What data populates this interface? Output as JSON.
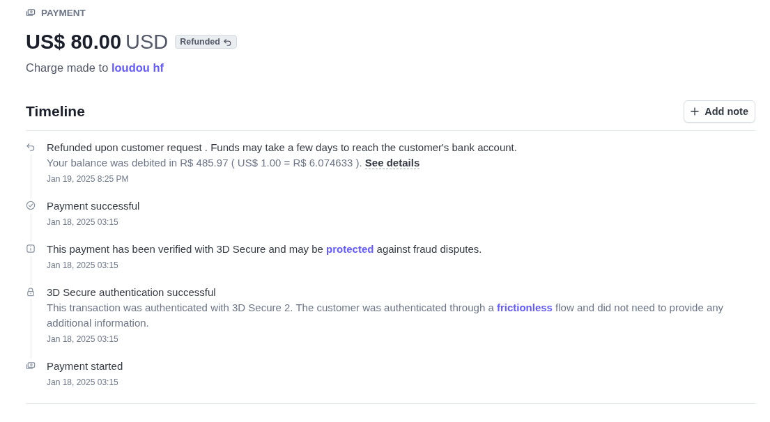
{
  "header": {
    "label": "PAYMENT",
    "amount": "US$ 80.00",
    "currency": "USD",
    "status": "Refunded",
    "description": [
      {
        "text": "Charge made to "
      },
      {
        "text": "loudou hf",
        "kind": "link"
      }
    ]
  },
  "timeline": {
    "title": "Timeline",
    "add_button": "Add note",
    "events": [
      {
        "kind": "refund",
        "title": [
          {
            "text": "Refunded upon customer request . Funds may take a few days to reach the customer's bank account."
          }
        ],
        "detail": [
          {
            "text": "Your balance was debited in R$ 485.97 ( US$ 1.00 = R$ 6.074633 ). "
          },
          {
            "text": "See details",
            "kind": "dashed-link"
          }
        ],
        "time": "Jan 19, 2025 8:25 PM"
      },
      {
        "kind": "success",
        "title": [
          {
            "text": "Payment successful"
          }
        ],
        "time": "Jan 18, 2025 03:15"
      },
      {
        "kind": "info",
        "title": [
          {
            "text": "This payment has been verified with 3D Secure and may be "
          },
          {
            "text": "protected",
            "kind": "link"
          },
          {
            "text": " against fraud disputes."
          }
        ],
        "time": "Jan 18, 2025 03:15"
      },
      {
        "kind": "lock",
        "title": [
          {
            "text": "3D Secure authentication successful"
          }
        ],
        "detail": [
          {
            "text": "This transaction was authenticated with 3D Secure 2. The customer was authenticated through a "
          },
          {
            "text": "frictionless",
            "kind": "link"
          },
          {
            "text": " flow and did not need to provide any additional information."
          }
        ],
        "time": "Jan 18, 2025 03:15"
      },
      {
        "kind": "payment",
        "title": [
          {
            "text": "Payment started"
          }
        ],
        "time": "Jan 18, 2025 03:15"
      }
    ]
  }
}
